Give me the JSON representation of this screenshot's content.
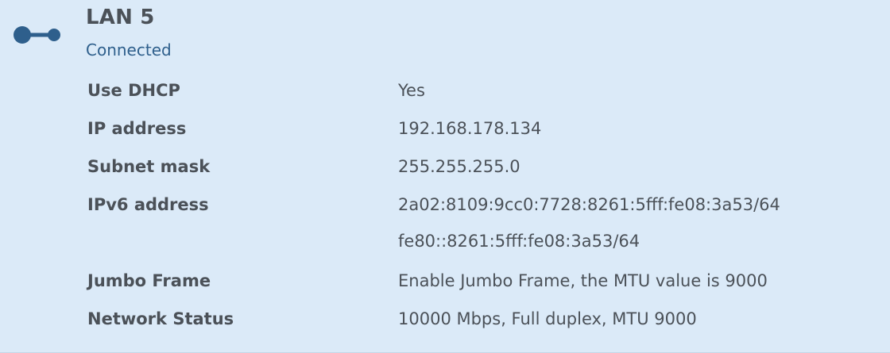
{
  "header": {
    "title": "LAN 5",
    "status": "Connected",
    "icon": "network-connector-icon"
  },
  "details": {
    "use_dhcp_label": "Use DHCP",
    "use_dhcp_value": "Yes",
    "ip_address_label": "IP address",
    "ip_address_value": "192.168.178.134",
    "subnet_mask_label": "Subnet mask",
    "subnet_mask_value": "255.255.255.0",
    "ipv6_address_label": "IPv6 address",
    "ipv6_address_values": [
      "2a02:8109:9cc0:7728:8261:5fff:fe08:3a53/64",
      "fe80::8261:5fff:fe08:3a53/64"
    ],
    "jumbo_frame_label": "Jumbo Frame",
    "jumbo_frame_value": "Enable Jumbo Frame, the MTU value is 9000",
    "network_status_label": "Network Status",
    "network_status_value": "10000 Mbps, Full duplex, MTU 9000"
  },
  "colors": {
    "background": "#dbeaf8",
    "accent": "#2e5f8c",
    "text": "#4b5158"
  }
}
